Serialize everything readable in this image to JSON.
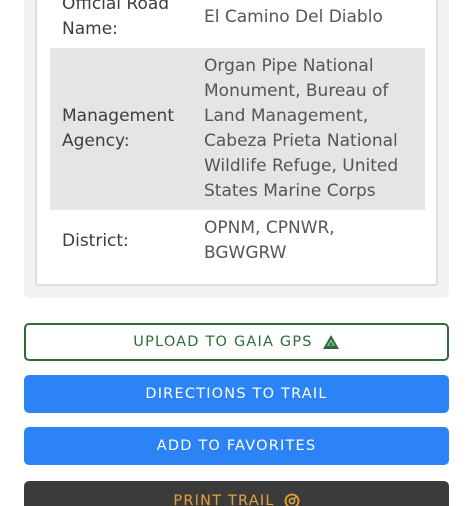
{
  "details": {
    "rows": [
      {
        "label": "Official Road Name:",
        "value": "El Camino Del Diablo"
      },
      {
        "label": "Management Agency:",
        "value": "Organ Pipe National Monument, Bureau of Land Management, Cabeza Prieta National Wildlife Refuge, United States Marine Corps"
      },
      {
        "label": "District:",
        "value": "OPNM, CPNWR, BGWGRW"
      }
    ]
  },
  "actions": {
    "gaia": {
      "label": "UPLOAD TO GAIA GPS",
      "icon": "gaia-gps-icon",
      "color": "#2e6b3a"
    },
    "directions": {
      "label": "DIRECTIONS TO TRAIL",
      "color": "#2b83f6"
    },
    "favorites": {
      "label": "ADD TO FAVORITES",
      "color": "#2b83f6"
    },
    "print": {
      "label": "PRINT TRAIL",
      "icon": "print-trail-icon",
      "color": "#e8a13a"
    }
  }
}
